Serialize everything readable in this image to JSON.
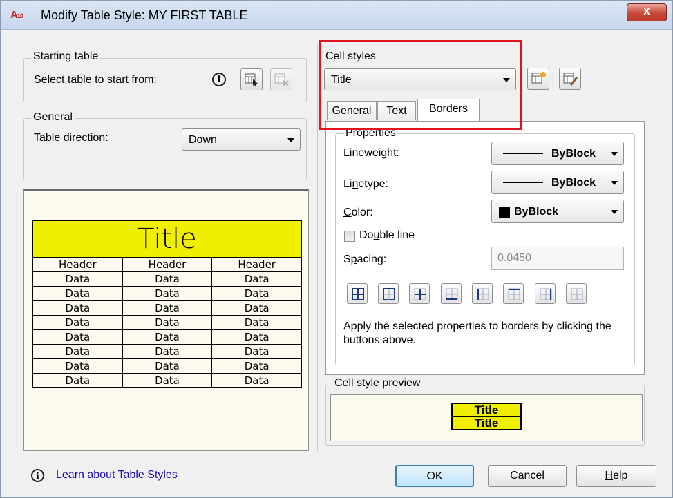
{
  "window": {
    "app_icon_text": "A",
    "app_icon_sub": "10",
    "title": "Modify Table Style: MY FIRST TABLE",
    "close_glyph": "X"
  },
  "starting_table": {
    "group_label": "Starting table",
    "select_label_pre": "S",
    "select_label_u": "e",
    "select_label_post": "lect table to start from:",
    "info_icon": "info-icon",
    "select_button_icon": "select-table-icon",
    "remove_button_icon": "remove-table-icon"
  },
  "general": {
    "group_label": "General",
    "direction_label_pre": "Table ",
    "direction_label_u": "d",
    "direction_label_post": "irection:",
    "direction_value": "Down"
  },
  "preview_table": {
    "title": "Title",
    "headers": [
      "Header",
      "Header",
      "Header"
    ],
    "rows": [
      [
        "Data",
        "Data",
        "Data"
      ],
      [
        "Data",
        "Data",
        "Data"
      ],
      [
        "Data",
        "Data",
        "Data"
      ],
      [
        "Data",
        "Data",
        "Data"
      ],
      [
        "Data",
        "Data",
        "Data"
      ],
      [
        "Data",
        "Data",
        "Data"
      ],
      [
        "Data",
        "Data",
        "Data"
      ],
      [
        "Data",
        "Data",
        "Data"
      ]
    ]
  },
  "cell_styles": {
    "label": "Cell styles",
    "selected": "Title",
    "new_style_icon": "new-cell-style-icon",
    "manage_styles_icon": "manage-cell-styles-icon"
  },
  "tabs": [
    {
      "label": "General",
      "active": false
    },
    {
      "label": "Text",
      "active": false
    },
    {
      "label": "Borders",
      "active": true
    }
  ],
  "borders": {
    "group_label": "Properties",
    "lineweight_label_u": "L",
    "lineweight_label_post": "ineweight:",
    "lineweight_value": "ByBlock",
    "linetype_label_pre": "Li",
    "linetype_label_u": "n",
    "linetype_label_post": "etype:",
    "linetype_value": "ByBlock",
    "color_label_u": "C",
    "color_label_post": "olor:",
    "color_value": "ByBlock",
    "color_swatch": "#000000",
    "double_line_pre": "Do",
    "double_line_u": "u",
    "double_line_post": "ble line",
    "spacing_label_pre": "S",
    "spacing_label_u": "p",
    "spacing_label_post": "acing:",
    "spacing_value": "0.0450",
    "buttons": [
      "all-borders-icon",
      "outside-borders-icon",
      "inside-borders-icon",
      "bottom-border-icon",
      "left-border-icon",
      "top-border-icon",
      "right-border-icon",
      "no-border-icon"
    ],
    "help_text": "Apply the selected properties to borders by clicking the buttons above."
  },
  "cell_style_preview": {
    "label": "Cell style preview",
    "line1": "Title",
    "line2": "Title"
  },
  "footer": {
    "learn_link": "Learn about Table Styles",
    "ok": "OK",
    "cancel": "Cancel",
    "help_u": "H",
    "help_post": "elp"
  },
  "colors": {
    "title_fill": "#f0ef00",
    "highlight_box": "#e0141f",
    "preview_bg": "#fdfbef"
  }
}
